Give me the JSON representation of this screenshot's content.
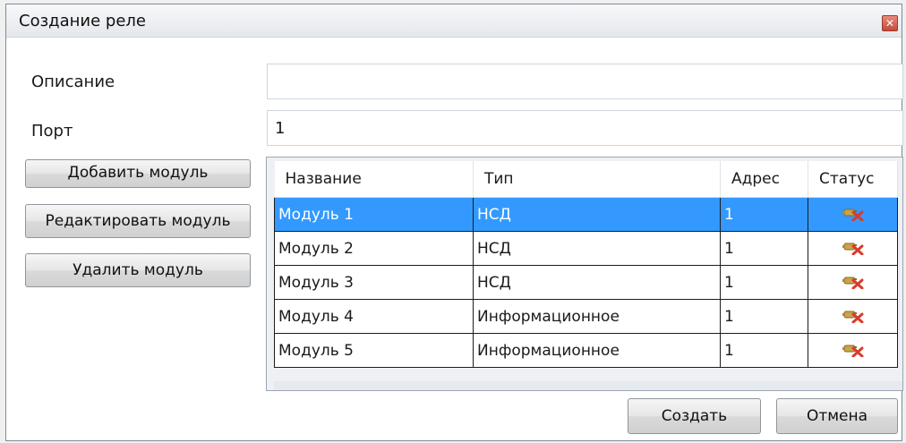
{
  "dialog": {
    "title": "Создание реле",
    "close_icon": "close-icon"
  },
  "form": {
    "description_label": "Описание",
    "description_value": "",
    "port_label": "Порт",
    "port_value": "1"
  },
  "side_buttons": {
    "add": "Добавить модуль",
    "edit": "Редактировать модуль",
    "delete": "Удалить модуль"
  },
  "table": {
    "columns": [
      "Название",
      "Тип",
      "Адрес",
      "Статус"
    ],
    "rows": [
      {
        "name": "Модуль 1",
        "type": "НСД",
        "address": "1",
        "status_icon": "disconnected-status-icon",
        "selected": true
      },
      {
        "name": "Модуль 2",
        "type": "НСД",
        "address": "1",
        "status_icon": "disconnected-status-icon",
        "selected": false
      },
      {
        "name": "Модуль 3",
        "type": "НСД",
        "address": "1",
        "status_icon": "disconnected-status-icon",
        "selected": false
      },
      {
        "name": "Модуль 4",
        "type": "Информационное",
        "address": "1",
        "status_icon": "disconnected-status-icon",
        "selected": false
      },
      {
        "name": "Модуль 5",
        "type": "Информационное",
        "address": "1",
        "status_icon": "disconnected-status-icon",
        "selected": false
      }
    ]
  },
  "footer": {
    "create": "Создать",
    "cancel": "Отмена"
  },
  "colors": {
    "selection": "#3399ff",
    "status_error": "#d93a2b"
  }
}
